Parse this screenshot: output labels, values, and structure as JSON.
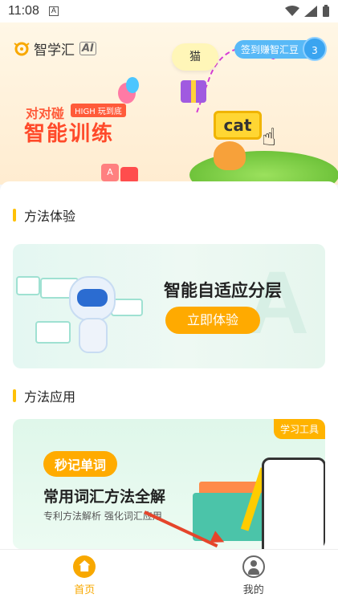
{
  "status_bar": {
    "time": "11:08",
    "notif_letter": "A"
  },
  "hero": {
    "brand": "智学汇",
    "brand_suffix": "AI",
    "cat_word": "猫",
    "bean_label": "签到赚智汇豆",
    "bean_count": "3",
    "slogan_small": "对对碰",
    "high_tag": "HIGH 玩到底",
    "slogan_big": "智能训练",
    "sign_word": "cat",
    "block_letter": "A"
  },
  "sections": {
    "experience": {
      "title": "方法体验",
      "card_heading": "智能自适应分层",
      "card_button": "立即体验",
      "watermark": "A"
    },
    "application": {
      "title": "方法应用",
      "tag": "学习工具",
      "pill": "秒记单词",
      "heading": "常用词汇方法全解",
      "subtitle": "专利方法解析  强化词汇应用"
    }
  },
  "tabbar": {
    "home": "首页",
    "me": "我的"
  },
  "colors": {
    "accent": "#f8a800",
    "annotation_arrow": "#e5452b"
  }
}
